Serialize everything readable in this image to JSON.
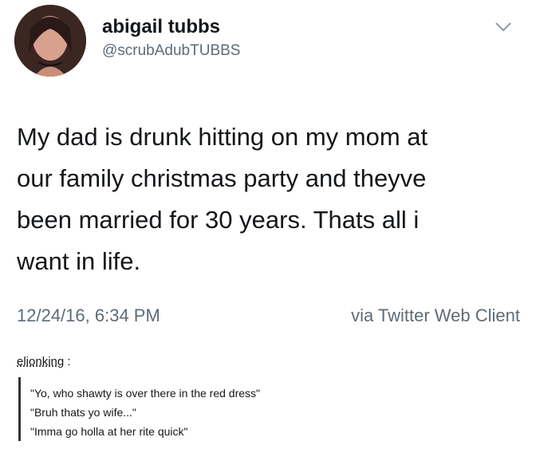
{
  "tweet": {
    "display_name": "abigail tubbs",
    "handle": "@scrubAdubTUBBS",
    "text_lines": [
      "My dad is drunk hitting on my mom at",
      "our family christmas party and theyve",
      "been married for 30 years. Thats all i",
      "want in life."
    ],
    "timestamp": "12/24/16, 6:34 PM",
    "source": "via Twitter Web Client",
    "menu_icon": "chevron-down-icon"
  },
  "comment": {
    "username": "elionking",
    "separator": ":",
    "quote_lines": [
      "\"Yo, who shawty is over there in the red dress\"",
      "\"Bruh thats yo wife...\"",
      "\"Imma go holla at her rite quick\""
    ]
  }
}
